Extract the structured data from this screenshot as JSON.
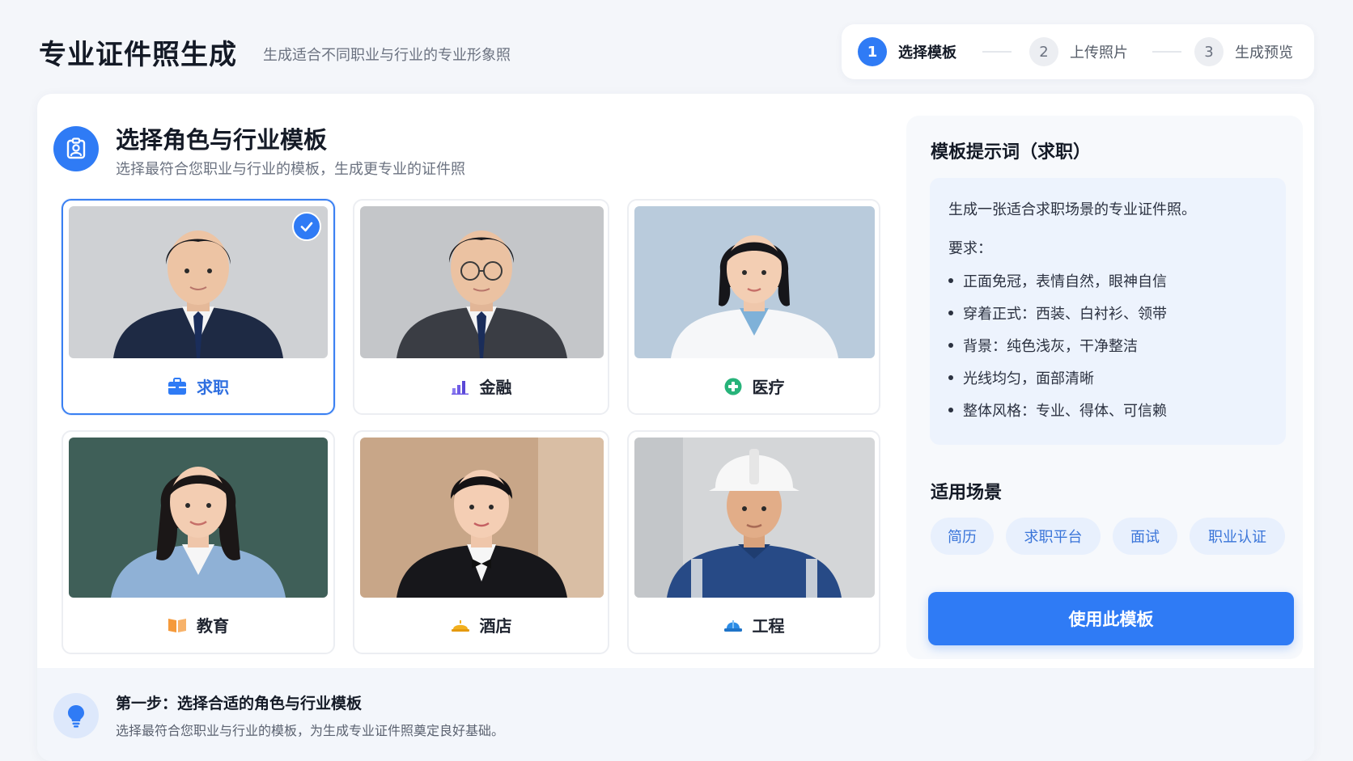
{
  "header": {
    "title": "专业证件照生成",
    "subtitle": "生成适合不同职业与行业的专业形象照"
  },
  "stepper": {
    "steps": [
      {
        "num": "1",
        "label": "选择模板",
        "active": true
      },
      {
        "num": "2",
        "label": "上传照片",
        "active": false
      },
      {
        "num": "3",
        "label": "生成预览",
        "active": false
      }
    ]
  },
  "section": {
    "title": "选择角色与行业模板",
    "subtitle": "选择最符合您职业与行业的模板，生成更专业的证件照",
    "icon": "id-badge-icon"
  },
  "templates": [
    {
      "label": "求职",
      "icon": "briefcase-icon",
      "icon_color": "#2f7bf5",
      "selected": true
    },
    {
      "label": "金融",
      "icon": "bar-chart-icon",
      "icon_color": "#6f5ce6",
      "selected": false
    },
    {
      "label": "医疗",
      "icon": "medical-cross-icon",
      "icon_color": "#27b37a",
      "selected": false
    },
    {
      "label": "教育",
      "icon": "book-icon",
      "icon_color": "#f59a3b",
      "selected": false
    },
    {
      "label": "酒店",
      "icon": "service-bell-icon",
      "icon_color": "#f2b01e",
      "selected": false
    },
    {
      "label": "工程",
      "icon": "hard-hat-icon",
      "icon_color": "#2b8ce6",
      "selected": false
    }
  ],
  "prompt": {
    "title": "模板提示词（求职）",
    "intro": "生成一张适合求职场景的专业证件照。",
    "requirements_label": "要求：",
    "bullets": [
      "正面免冠，表情自然，眼神自信",
      "穿着正式：西装、白衬衫、领带",
      "背景：纯色浅灰，干净整洁",
      "光线均匀，面部清晰",
      "整体风格：专业、得体、可信赖"
    ]
  },
  "scenes": {
    "title": "适用场景",
    "tags": [
      "简历",
      "求职平台",
      "面试",
      "职业认证"
    ]
  },
  "use_button": "使用此模板",
  "tip": {
    "title": "第一步：选择合适的角色与行业模板",
    "text": "选择最符合您职业与行业的模板，为生成专业证件照奠定良好基础。",
    "icon": "lightbulb-icon"
  },
  "colors": {
    "accent": "#2f7bf5",
    "page_bg": "#f4f6fa",
    "prompt_bg": "#edf3fd",
    "tag_bg": "#e8f0fd"
  }
}
